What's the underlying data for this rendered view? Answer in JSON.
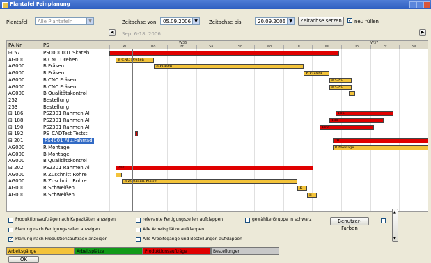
{
  "window": {
    "title": "Plantafel Feinplanung"
  },
  "toolbar": {
    "plantafel_label": "Plantafel",
    "plantafel_value": "Alle Plantafeln",
    "zeitachse_von_label": "Zeitachse von",
    "zeitachse_von_value": "05.09.2006",
    "zeitachse_bis_label": "Zeitachse bis",
    "zeitachse_bis_value": "20.09.2006",
    "set_button": "Zeitachse setzen",
    "neu_fuellen": "neu füllen"
  },
  "nav": {
    "period_label": "Sep. 6-18, 2006",
    "prev": "◀",
    "next": "▶"
  },
  "grid": {
    "col_pa": "PA-Nr.",
    "col_ps": "PS",
    "weeks": [
      "W36",
      "W37"
    ],
    "days": [
      "Mi",
      "Do",
      "Fr",
      "Sa",
      "So",
      "Mo",
      "Di",
      "Mi",
      "Do",
      "Fr",
      "Sa"
    ],
    "rows": [
      {
        "pa": "⊟ 57",
        "ps": "PS0000001 Skateb"
      },
      {
        "pa": "AG000",
        "ps": "B CNC Drehen"
      },
      {
        "pa": "AG000",
        "ps": "B Fräsen"
      },
      {
        "pa": "AG000",
        "ps": "R Fräsen"
      },
      {
        "pa": "AG000",
        "ps": "B CNC Fräsen"
      },
      {
        "pa": "AG000",
        "ps": "B CNC Fräsen"
      },
      {
        "pa": "AG000",
        "ps": "B Qualitätskontrol"
      },
      {
        "pa": "252",
        "ps": "Bestellung"
      },
      {
        "pa": "253",
        "ps": "Bestellung"
      },
      {
        "pa": "⊞ 186",
        "ps": "PS2301 Rahmen Al"
      },
      {
        "pa": "⊞ 188",
        "ps": "PS2301 Rahmen Al"
      },
      {
        "pa": "⊞ 190",
        "ps": "PS2301 Rahmen Al"
      },
      {
        "pa": "⊞ 192",
        "ps": "PS_CADTest Testst"
      },
      {
        "pa": "⊟ 201",
        "ps": "PS4001 Alu.Fahrrad"
      },
      {
        "pa": "AG000",
        "ps": "R Montage"
      },
      {
        "pa": "AG000",
        "ps": "B Montage"
      },
      {
        "pa": "AG000",
        "ps": "B Qualitätskontrol"
      },
      {
        "pa": "⊟ 202",
        "ps": "PS2301 Rahmen Al"
      },
      {
        "pa": "AG000",
        "ps": "R Zuschnitt Rohre"
      },
      {
        "pa": "AG000",
        "ps": "B Zuschnitt Rohre"
      },
      {
        "pa": "AG000",
        "ps": "R Schweißen"
      },
      {
        "pa": "AG000",
        "ps": "B Schweißen"
      }
    ],
    "bars": [
      {
        "row": 0,
        "color": "red",
        "start": 0.0,
        "end": 0.72,
        "text": ""
      },
      {
        "row": 1,
        "color": "yel",
        "start": 0.02,
        "end": 0.14,
        "text": "B CNC Drehen"
      },
      {
        "row": 2,
        "color": "yel",
        "start": 0.14,
        "end": 0.61,
        "text": "B Fräsen"
      },
      {
        "row": 3,
        "color": "yel",
        "start": 0.61,
        "end": 0.69,
        "text": "R Fräsen"
      },
      {
        "row": 4,
        "color": "yel",
        "start": 0.69,
        "end": 0.76,
        "text": "B CNC"
      },
      {
        "row": 5,
        "color": "yel",
        "start": 0.69,
        "end": 0.76,
        "text": "B CNC"
      },
      {
        "row": 6,
        "color": "yel",
        "start": 0.75,
        "end": 0.77,
        "text": ""
      },
      {
        "row": 9,
        "color": "red",
        "start": 0.71,
        "end": 0.89,
        "text": "186"
      },
      {
        "row": 10,
        "color": "red",
        "start": 0.69,
        "end": 0.86,
        "text": "188"
      },
      {
        "row": 11,
        "color": "red",
        "start": 0.66,
        "end": 0.83,
        "text": "190"
      },
      {
        "row": 12,
        "color": "red",
        "start": 0.08,
        "end": 0.09,
        "text": ""
      },
      {
        "row": 13,
        "color": "red",
        "start": 0.7,
        "end": 1.0,
        "text": "201"
      },
      {
        "row": 14,
        "color": "yel",
        "start": 0.7,
        "end": 1.0,
        "text": "R Montage"
      },
      {
        "row": 17,
        "color": "red",
        "start": 0.02,
        "end": 0.64,
        "text": "202"
      },
      {
        "row": 18,
        "color": "yel",
        "start": 0.02,
        "end": 0.04,
        "text": ""
      },
      {
        "row": 19,
        "color": "yel",
        "start": 0.04,
        "end": 0.59,
        "text": "B Zuschnitt Rohre"
      },
      {
        "row": 20,
        "color": "yel",
        "start": 0.59,
        "end": 0.62,
        "text": "R"
      },
      {
        "row": 21,
        "color": "yel",
        "start": 0.62,
        "end": 0.65,
        "text": "B"
      }
    ]
  },
  "options": [
    {
      "label": "Produktionsaufträge nach Kapazitäten anzeigen",
      "checked": false
    },
    {
      "label": "Planung nach Fertigungszeilen anzeigen",
      "checked": false
    },
    {
      "label": "Planung nach Produktionsaufträge anzeigen",
      "checked": true
    },
    {
      "label": "relevante Fertigungszeilen aufklappen",
      "checked": false
    },
    {
      "label": "Alle Arbeitsplätze aufklappen",
      "checked": false
    },
    {
      "label": "Alle Arbeitsgänge und Bestellungen aufklappen",
      "checked": false
    },
    {
      "label": "gewählte Gruppe in schwarz",
      "checked": false
    }
  ],
  "user_colors_button": "Benutzer-Farben",
  "legend": [
    {
      "label": "Arbeitsgänge",
      "color": "#f3c33a"
    },
    {
      "label": "Arbeitsplätze",
      "color": "#119a18"
    },
    {
      "label": "Produktionsaufträge",
      "color": "#e00000"
    },
    {
      "label": "Bestellungen",
      "color": "#c8c8c8"
    }
  ],
  "ok_button": "OK"
}
